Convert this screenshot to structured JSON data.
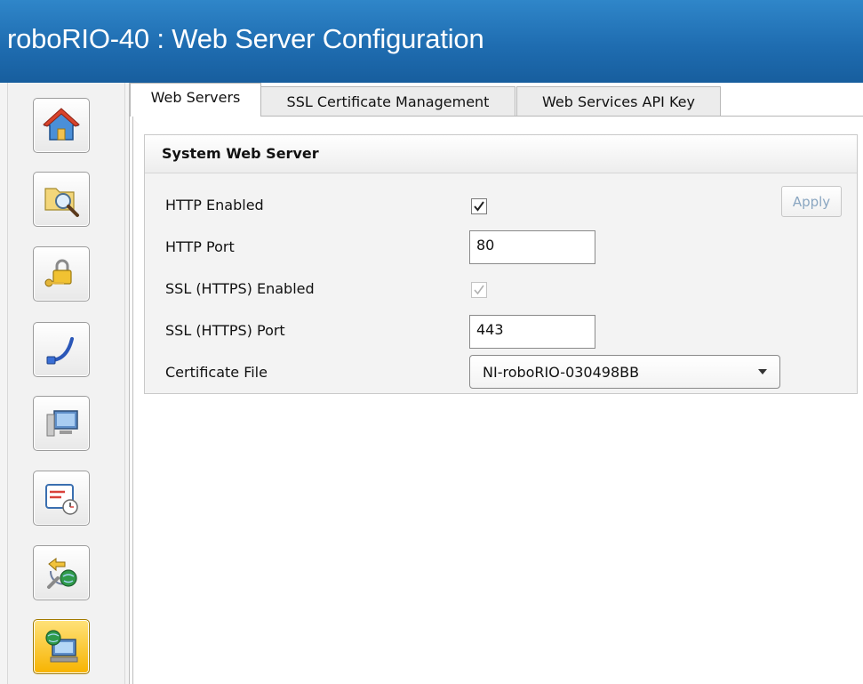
{
  "window": {
    "title": "roboRIO-40 : Web Server Configuration"
  },
  "sidebar": {
    "items": [
      {
        "icon": "home-icon"
      },
      {
        "icon": "folder-search-icon"
      },
      {
        "icon": "security-lock-icon"
      },
      {
        "icon": "network-cable-icon"
      },
      {
        "icon": "monitor-icon"
      },
      {
        "icon": "schedule-clock-icon"
      },
      {
        "icon": "network-tools-icon"
      },
      {
        "icon": "web-server-icon",
        "active": true
      }
    ]
  },
  "tabs": [
    {
      "label": "Web Servers",
      "active": true
    },
    {
      "label": "SSL Certificate Management",
      "active": false
    },
    {
      "label": "Web Services API Key",
      "active": false
    }
  ],
  "panel": {
    "title": "System Web Server",
    "apply_label": "Apply",
    "fields": {
      "http_enabled": {
        "label": "HTTP Enabled",
        "checked": true
      },
      "http_port": {
        "label": "HTTP Port",
        "value": "80"
      },
      "ssl_enabled": {
        "label": "SSL (HTTPS) Enabled",
        "checked": true,
        "disabled": true
      },
      "ssl_port": {
        "label": "SSL (HTTPS) Port",
        "value": "443"
      },
      "cert_file": {
        "label": "Certificate File",
        "value": "NI-roboRIO-030498BB"
      }
    }
  },
  "colors": {
    "titlebar": "#1f6db1",
    "active_nav": "#f7b300"
  }
}
